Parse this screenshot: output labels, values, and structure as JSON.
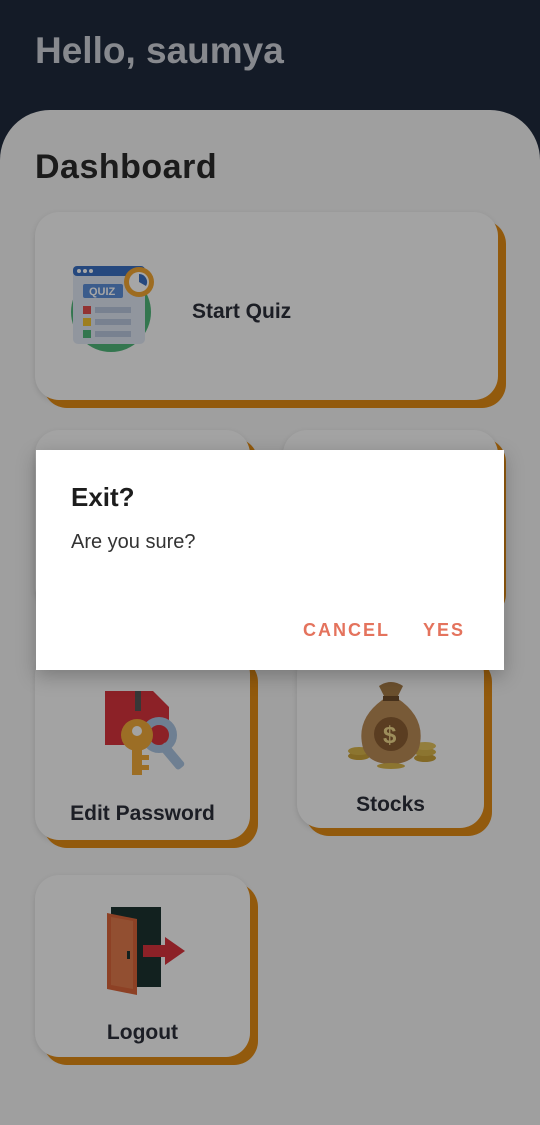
{
  "header": {
    "greeting": "Hello, saumya"
  },
  "dashboard": {
    "title": "Dashboard",
    "cards": {
      "start_quiz": {
        "label": "Start Quiz",
        "icon": "quiz-icon"
      },
      "edit_password": {
        "label": "Edit Password",
        "icon": "key-lock-icon"
      },
      "stocks": {
        "label": "Stocks",
        "icon": "money-bag-icon"
      },
      "logout": {
        "label": "Logout",
        "icon": "exit-door-icon"
      }
    }
  },
  "dialog": {
    "title": "Exit?",
    "message": "Are you sure?",
    "cancel_label": "CANCEL",
    "yes_label": "YES"
  },
  "colors": {
    "header_bg": "#1f2a3d",
    "card_shadow": "#e08a14",
    "dialog_button": "#e4735d"
  }
}
